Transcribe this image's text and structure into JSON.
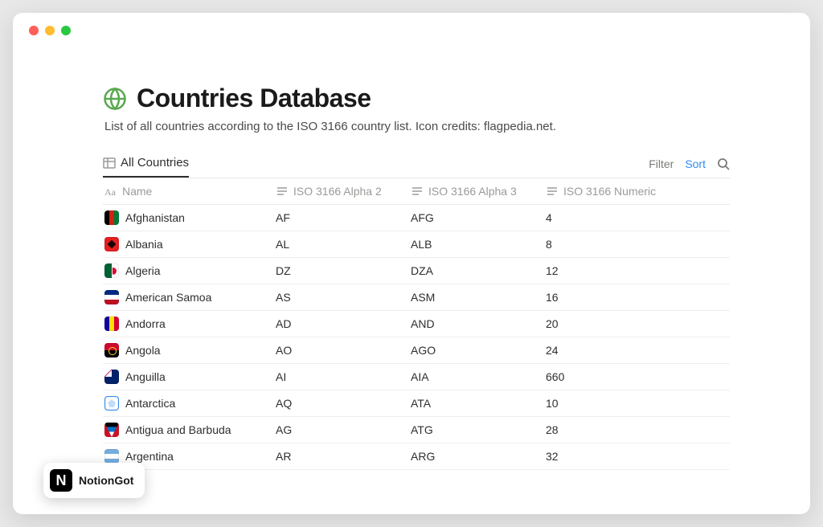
{
  "header": {
    "title": "Countries Database",
    "subtitle": "List of all countries according to the ISO 3166 country list. Icon credits: flagpedia.net."
  },
  "view": {
    "tab_label": "All Countries",
    "filter_label": "Filter",
    "sort_label": "Sort"
  },
  "columns": {
    "name": "Name",
    "alpha2": "ISO 3166 Alpha 2",
    "alpha3": "ISO 3166 Alpha 3",
    "numeric": "ISO 3166 Numeric"
  },
  "rows": [
    {
      "name": "Afghanistan",
      "alpha2": "AF",
      "alpha3": "AFG",
      "numeric": "4",
      "flag": "flag-af"
    },
    {
      "name": "Albania",
      "alpha2": "AL",
      "alpha3": "ALB",
      "numeric": "8",
      "flag": "flag-al"
    },
    {
      "name": "Algeria",
      "alpha2": "DZ",
      "alpha3": "DZA",
      "numeric": "12",
      "flag": "flag-dz"
    },
    {
      "name": "American Samoa",
      "alpha2": "AS",
      "alpha3": "ASM",
      "numeric": "16",
      "flag": "flag-as"
    },
    {
      "name": "Andorra",
      "alpha2": "AD",
      "alpha3": "AND",
      "numeric": "20",
      "flag": "flag-ad"
    },
    {
      "name": "Angola",
      "alpha2": "AO",
      "alpha3": "AGO",
      "numeric": "24",
      "flag": "flag-ao"
    },
    {
      "name": "Anguilla",
      "alpha2": "AI",
      "alpha3": "AIA",
      "numeric": "660",
      "flag": "flag-ai"
    },
    {
      "name": "Antarctica",
      "alpha2": "AQ",
      "alpha3": "ATA",
      "numeric": "10",
      "flag": "flag-aq"
    },
    {
      "name": "Antigua and Barbuda",
      "alpha2": "AG",
      "alpha3": "ATG",
      "numeric": "28",
      "flag": "flag-ag"
    },
    {
      "name": "Argentina",
      "alpha2": "AR",
      "alpha3": "ARG",
      "numeric": "32",
      "flag": "flag-ar"
    }
  ],
  "badge": {
    "label": "NotionGot",
    "logo_letter": "N"
  }
}
